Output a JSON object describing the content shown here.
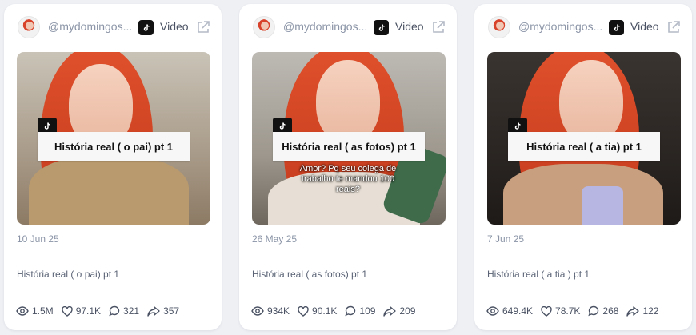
{
  "cards": [
    {
      "handle": "@mydomingos...",
      "type_label": "Video",
      "thumb_title": "História real ( o pai) pt 1",
      "thumb_caption": "",
      "date": "10 Jun 25",
      "description": "História real ( o pai) pt 1",
      "views": "1.5M",
      "likes": "97.1K",
      "comments": "321",
      "shares": "357"
    },
    {
      "handle": "@mydomingos...",
      "type_label": "Video",
      "thumb_title": "História real ( as fotos) pt 1",
      "thumb_caption": "Amor? Pq seu colega de trabalho te mandou 100 reais?",
      "date": "26 May 25",
      "description": "História real ( as fotos) pt 1",
      "views": "934K",
      "likes": "90.1K",
      "comments": "109",
      "shares": "209"
    },
    {
      "handle": "@mydomingos...",
      "type_label": "Video",
      "thumb_title": "História real ( a tia) pt 1",
      "thumb_caption": "",
      "date": "7 Jun 25",
      "description": "História real ( a tia ) pt 1",
      "views": "649.4K",
      "likes": "78.7K",
      "comments": "268",
      "shares": "122"
    }
  ],
  "colors": {
    "hair": "#d8452a",
    "card_bg": "#ffffff",
    "page_bg": "#eef0f4",
    "muted_text": "#8a94a6"
  }
}
